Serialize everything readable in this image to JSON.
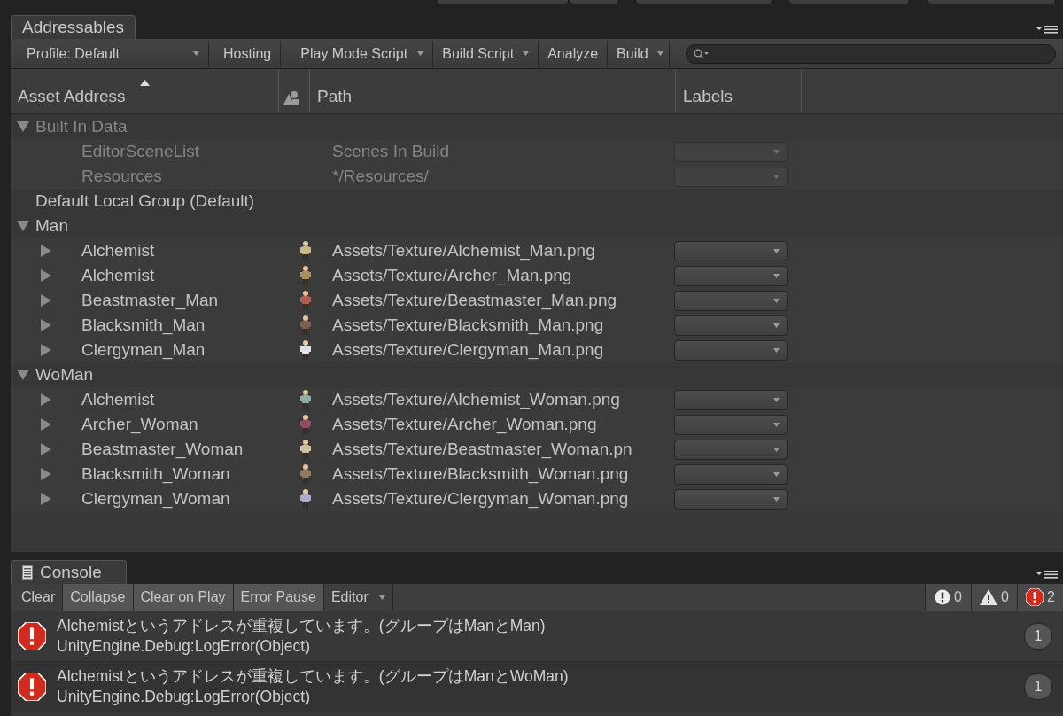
{
  "window_tab": {
    "title": "Addressables"
  },
  "toolbar": [
    {
      "label": "Profile: Default",
      "kind": "dropdown"
    },
    {
      "label": "Hosting",
      "kind": "button"
    },
    {
      "label": "Play Mode Script",
      "kind": "dropdown"
    },
    {
      "label": "Build Script",
      "kind": "dropdown"
    },
    {
      "label": "Analyze",
      "kind": "button"
    },
    {
      "label": "Build",
      "kind": "dropdown"
    }
  ],
  "table": {
    "columns": [
      "Asset Address",
      "Path",
      "Labels"
    ],
    "groups": [
      {
        "name": "Built In Data",
        "kind": "folder",
        "expanded": true,
        "children": [
          {
            "address": "EditorSceneList",
            "path": "Scenes In Build",
            "disabled": true,
            "thumbnail": false
          },
          {
            "address": "Resources",
            "path": "*/Resources/",
            "disabled": true,
            "thumbnail": false
          }
        ]
      },
      {
        "name": "Default Local Group (Default)",
        "kind": "empty"
      },
      {
        "name": "Man",
        "kind": "folder",
        "expanded": true,
        "children": [
          {
            "address": "Alchemist",
            "path": "Assets/Texture/Alchemist_Man.png",
            "disabled": false,
            "thumbnail": true,
            "expanded": false
          },
          {
            "address": "Alchemist",
            "path": "Assets/Texture/Archer_Man.png",
            "disabled": false,
            "thumbnail": true,
            "expanded": false
          },
          {
            "address": "Beastmaster_Man",
            "path": "Assets/Texture/Beastmaster_Man.png",
            "disabled": false,
            "thumbnail": true,
            "expanded": false
          },
          {
            "address": "Blacksmith_Man",
            "path": "Assets/Texture/Blacksmith_Man.png",
            "disabled": false,
            "thumbnail": true,
            "expanded": false
          },
          {
            "address": "Clergyman_Man",
            "path": "Assets/Texture/Clergyman_Man.png",
            "disabled": false,
            "thumbnail": true,
            "expanded": false
          }
        ]
      },
      {
        "name": "WoMan",
        "kind": "folder",
        "expanded": true,
        "children": [
          {
            "address": "Alchemist",
            "path": "Assets/Texture/Alchemist_Woman.png",
            "disabled": false,
            "thumbnail": true,
            "expanded": false
          },
          {
            "address": "Archer_Woman",
            "path": "Assets/Texture/Archer_Woman.png",
            "disabled": false,
            "thumbnail": true,
            "expanded": false
          },
          {
            "address": "Beastmaster_Woman",
            "path": "Assets/Texture/Beastmaster_Woman.pn",
            "disabled": false,
            "thumbnail": true,
            "expanded": false
          },
          {
            "address": "Blacksmith_Woman",
            "path": "Assets/Texture/Blacksmith_Woman.png",
            "disabled": false,
            "thumbnail": true,
            "expanded": false
          },
          {
            "address": "Clergyman_Woman",
            "path": "Assets/Texture/Clergyman_Woman.png",
            "disabled": false,
            "thumbnail": true,
            "expanded": false
          }
        ]
      }
    ]
  },
  "console": {
    "title": "Console",
    "toolbar": [
      {
        "label": "Clear",
        "kind": "button",
        "on": false
      },
      {
        "label": "Collapse",
        "kind": "toggle",
        "on": true
      },
      {
        "label": "Clear on Play",
        "kind": "toggle",
        "on": true
      },
      {
        "label": "Error Pause",
        "kind": "toggle",
        "on": true
      },
      {
        "label": "Editor",
        "kind": "dropdown",
        "on": false
      }
    ],
    "counters": [
      {
        "kind": "info",
        "count": "0"
      },
      {
        "kind": "warning",
        "count": "0"
      },
      {
        "kind": "error",
        "count": "2"
      }
    ],
    "messages": [
      {
        "kind": "error",
        "line1": "Alchemistというアドレスが重複しています。(グループはManとMan)",
        "line2": "UnityEngine.Debug:LogError(Object)",
        "count": "1"
      },
      {
        "kind": "error",
        "line1": "Alchemistというアドレスが重複しています。(グループはManとWoMan)",
        "line2": "UnityEngine.Debug:LogError(Object)",
        "count": "1"
      }
    ]
  }
}
